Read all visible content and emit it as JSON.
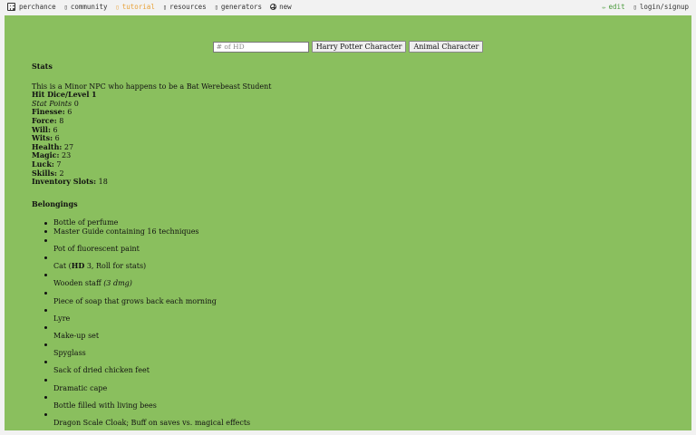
{
  "nav": {
    "brand": "perchance",
    "community": "community",
    "tutorial": "tutorial",
    "resources": "resources",
    "generators": "generators",
    "new": "new",
    "edit": "edit",
    "login": "login/signup"
  },
  "controls": {
    "hd_placeholder": "# of HD",
    "hp_button": "Harry Potter Character",
    "animal_button": "Animal Character"
  },
  "stats": {
    "heading": "Stats",
    "intro": "This is a Minor NPC who happens to be a Bat Werebeast Student",
    "hit_dice_label": "Hit Dice/Level",
    "hit_dice_value": "1",
    "stat_points_label": "Stat Points",
    "stat_points_value": "0",
    "finesse_label": "Finesse:",
    "finesse_value": "6",
    "force_label": "Force:",
    "force_value": "8",
    "will_label": "Will:",
    "will_value": "6",
    "wits_label": "Wits:",
    "wits_value": "6",
    "health_label": "Health:",
    "health_value": "27",
    "magic_label": "Magic:",
    "magic_value": "23",
    "luck_label": "Luck:",
    "luck_value": "7",
    "skills_label": "Skills:",
    "skills_value": "2",
    "inventory_label": "Inventory Slots:",
    "inventory_value": "18"
  },
  "belongings": {
    "heading": "Belongings",
    "flat": [
      "Bottle of perfume",
      "Master Guide containing 16 techniques"
    ],
    "cat_prefix": "Cat (",
    "cat_hd": "HD",
    "cat_suffix": " 3, Roll for stats)",
    "staff_text": "Wooden staff",
    "staff_dmg": "(3 dmg)",
    "nested": [
      "Pot of fluorescent paint",
      "Piece of soap that grows back each morning",
      "Lyre",
      "Make-up set",
      "Spyglass",
      "Sack of dried chicken feet",
      "Dramatic cape",
      "Bottle filled with living bees",
      "Dragon Scale Cloak; Buff on saves vs. magical effects"
    ]
  }
}
